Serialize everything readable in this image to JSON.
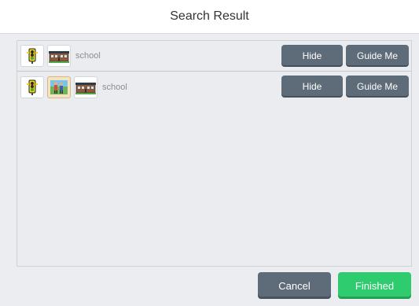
{
  "dialog": {
    "title": "Search Result"
  },
  "results": [
    {
      "label": "school",
      "icons": [
        "traffic-light-icon",
        "school-building-icon"
      ],
      "hide_label": "Hide",
      "guide_label": "Guide Me"
    },
    {
      "label": "school",
      "icons": [
        "traffic-light-icon",
        "crossing-guard-icon",
        "school-building-icon"
      ],
      "hide_label": "Hide",
      "guide_label": "Guide Me"
    }
  ],
  "footer": {
    "cancel_label": "Cancel",
    "finished_label": "Finished"
  },
  "colors": {
    "button_gray": "#5d6c78",
    "finished_green": "#2ecc6f",
    "panel_bg": "#eaecef"
  }
}
